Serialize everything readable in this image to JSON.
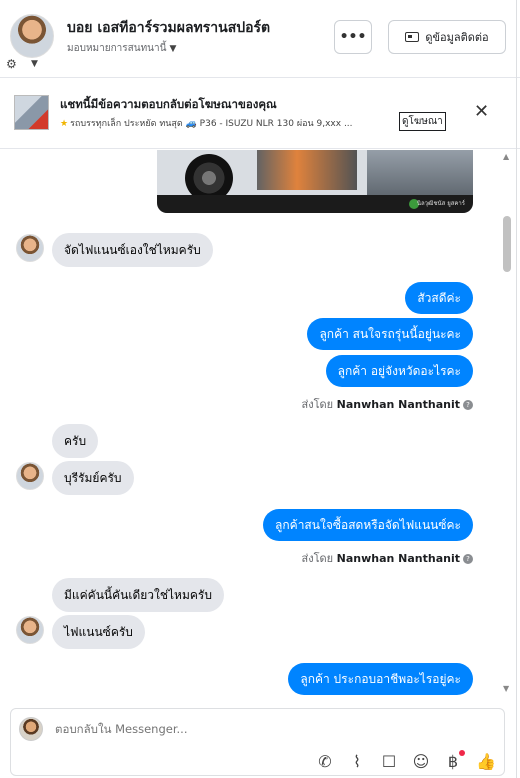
{
  "header": {
    "title": "บอย เอสทีอาร์รวมผลทรานสปอร์ต",
    "assign_label": "มอบหมายการสนทนานี้",
    "more_label": "•••",
    "contact_button": "ดูข้อมูลติดต่อ"
  },
  "ad_banner": {
    "title": "แชทนี้มีข้อความตอบกลับต่อโฆษณาของคุณ",
    "subtitle": "รถบรรทุกเล็ก ประหยัด ทนสุด 🚙 P36 - ISUZU NLR 130 ผ่อน 9,xxx ...",
    "view_ad_link": "ดูโฆษณา",
    "close": "✕"
  },
  "ad_image": {
    "caption": "นิลวุฒิชนัส ยูสคาร์"
  },
  "messages": {
    "m1": "จัดไฟแนนซ์เองใช่ไหมครับ",
    "m2": "สัวสดีค่ะ",
    "m3": "ลูกค้า สนใจรถรุ่นนี้อยู่นะคะ",
    "m4": "ลูกค้า  อยู่จังหวัดอะไรคะ",
    "sent_by_1_prefix": "ส่งโดย",
    "sent_by_1_name": "Nanwhan Nanthanit",
    "m5": "ครับ",
    "m6": "บุรีรัมย์ครับ",
    "m7": "ลูกค้าสนใจซื้อสดหรือจัดไฟแนนซ์คะ",
    "sent_by_2_prefix": "ส่งโดย",
    "sent_by_2_name": "Nanwhan Nanthanit",
    "m8": "มีแค่คันนี้คันเดียวใช่ไหมครับ",
    "m9": "ไฟแนนซ์ครับ",
    "m10": "ลูกค้า ประกอบอาชีพอะไรอยู่คะ"
  },
  "composer": {
    "placeholder": "ตอบกลับใน Messenger..."
  },
  "icons": {
    "filter": "filter-icon",
    "call": "phone-plus-icon",
    "attach": "paperclip-icon",
    "saved_reply": "chat-bubble-icon",
    "emoji": "emoji-icon",
    "payment": "baht-icon",
    "like": "thumbs-up-icon"
  },
  "colors": {
    "outgoing_bubble": "#0084ff",
    "incoming_bubble": "#e4e6eb",
    "notification_dot": "#f02849"
  }
}
